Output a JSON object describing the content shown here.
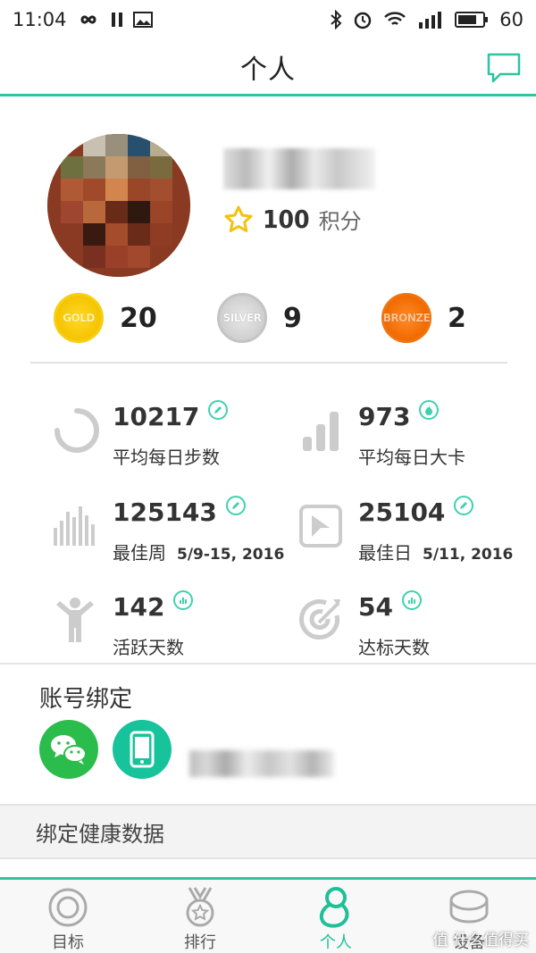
{
  "status_bar": {
    "time": "11:04",
    "battery": "60"
  },
  "header": {
    "title": "个人",
    "chat_icon": "chat-bubble-icon"
  },
  "profile": {
    "points_value": "100",
    "points_unit": "积分"
  },
  "medals": [
    {
      "name": "GOLD",
      "count": "20",
      "color": "#f5c400"
    },
    {
      "name": "SILVER",
      "count": "9",
      "color": "#c4c4c4"
    },
    {
      "name": "BRONZE",
      "count": "2",
      "color": "#f06a00"
    }
  ],
  "stats": {
    "avg_steps": {
      "value": "10217",
      "label": "平均每日步数"
    },
    "avg_calories": {
      "value": "973",
      "label": "平均每日大卡"
    },
    "best_week": {
      "value": "125143",
      "label": "最佳周",
      "date": "5/9-15, 2016"
    },
    "best_day": {
      "value": "25104",
      "label": "最佳日",
      "date": "5/11, 2016"
    },
    "active_days": {
      "value": "142",
      "label": "活跃天数"
    },
    "goal_days": {
      "value": "54",
      "label": "达标天数"
    }
  },
  "binding": {
    "title": "账号绑定"
  },
  "health": {
    "label": "绑定健康数据"
  },
  "tabs": [
    {
      "label": "目标",
      "icon": "target-icon"
    },
    {
      "label": "排行",
      "icon": "medal-icon"
    },
    {
      "label": "个人",
      "icon": "person-icon",
      "active": true
    },
    {
      "label": "设备",
      "icon": "band-icon"
    }
  ],
  "watermark": "值 什么值得买",
  "colors": {
    "accent": "#2ec4a0",
    "wechat": "#2bbd4c",
    "phone": "#17c39b",
    "icon_gray": "#cccccc"
  }
}
